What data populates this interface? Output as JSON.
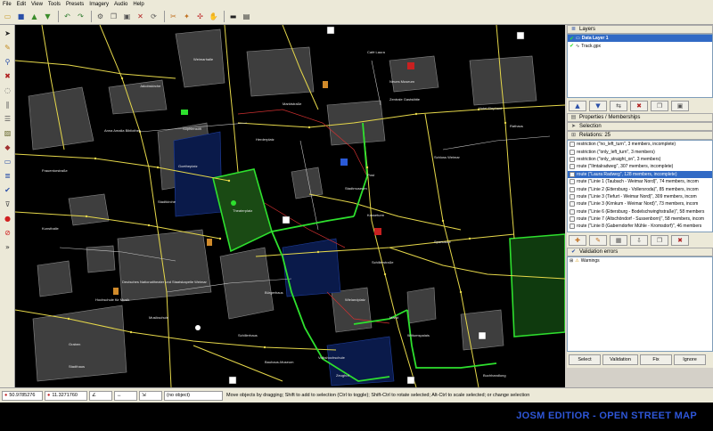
{
  "menu": [
    "File",
    "Edit",
    "View",
    "Tools",
    "Presets",
    "Imagery",
    "Audio",
    "Help"
  ],
  "toolbar_icons": [
    "open-icon",
    "save-icon",
    "upload-icon",
    "download-icon",
    "undo-icon",
    "redo-icon",
    "preferences-icon",
    "copy-icon",
    "paste-icon",
    "delete-icon",
    "refresh-icon",
    "scissors-icon",
    "wand-icon",
    "arrows-icon",
    "hand-icon",
    "bus-icon",
    "train-icon"
  ],
  "left_tools": [
    "select-icon",
    "draw-icon",
    "zoom-icon",
    "delete-icon",
    "lasso-icon",
    "parallel-icon",
    "align-icon",
    "photo-icon",
    "waypoint-icon",
    "bus-stop-icon",
    "layers-icon",
    "check-icon",
    "filter-icon",
    "error-icon",
    "cancel-icon"
  ],
  "layers": {
    "title": "Layers",
    "items": [
      {
        "name": "Data Layer 1",
        "selected": true
      },
      {
        "name": "Track.gpx",
        "selected": false
      }
    ]
  },
  "properties": {
    "title": "Properties / Memberships"
  },
  "selection": {
    "title": "Selection"
  },
  "relations": {
    "title": "Relations: 25",
    "items": [
      "restriction (\"no_left_turn\", 3 members, incomplete)",
      "restriction (\"only_left_turn\", 3 members)",
      "restriction (\"only_straight_on\", 3 members)",
      "route (\"Ilmtalradweg\", 307 members, incomplete)",
      "route (\"Laura Radweg\", 128 members, incomplete)",
      "route (\"Linie 1 (Taubach - Weimar Nord)\", 74 members, incom",
      "route (\"Linie 2 (Ettersburg - Vollersroda)\", 85 members, incom",
      "route (\"Linie 3 (Tiefurt - Weimar Nord)\", 309 members, incom",
      "route (\"Linie 3 (Kirnkum - Weimar Nord)\", 73 members, incom",
      "route (\"Linie 6 (Ettersburg - Bodelschwinghstraße)\", 58 members",
      "route (\"Linie 7 (Altschöndorf - Sussenborn)\", 58 members, incom",
      "route (\"Linie 8 (Gaberndorfer Mühle - Kromsdorf)\", 46 members"
    ],
    "selected_index": 4
  },
  "validation": {
    "title": "Validation errors",
    "warnings_label": "Warnings",
    "buttons": [
      "Select",
      "Validation",
      "Fix",
      "Ignore"
    ]
  },
  "status": {
    "lat": "50.9785276",
    "lon": "11.3271760",
    "object": "(no object)",
    "hint": "Move objects by dragging; Shift to add to selection (Ctrl to toggle); Shift-Ctrl to rotate selected; Alt-Ctrl to scale selected; or change selection"
  },
  "banner": "JOSM EDITIOR - OPEN STREET MAP",
  "colors": {
    "road": "#e6d84a",
    "route_green": "#2ee02e",
    "building": "#4b4b4b",
    "selected_row": "#316ac5",
    "banner_text": "#2e56d8"
  },
  "map_labels": [
    "Theaterplatz",
    "Wielandplatz",
    "Goetheplatz",
    "Sophienstift",
    "Marktstraße",
    "Schillerstraße",
    "Frauentorstraße",
    "Deutsches Nationaltheater und Staatskapelle Weimar",
    "Zentrale Gaststätte",
    "Rathaus",
    "Stadtmuseum",
    "Schloss Weimar",
    "Herderplatz",
    "Graben",
    "Bauhaus-Museum",
    "Kasseturm",
    "Wittumspalais",
    "Schillerhaus",
    "Hotel Elephant",
    "Anna Amalia Bibliothek",
    "Musikschule",
    "Buchhandlung",
    "Café Laura",
    "Stadthaus",
    "Zeughof",
    "Markt",
    "Post",
    "Volkshochschule",
    "Sparkasse",
    "Jakobskirche",
    "Hochschule für Musik",
    "Bürgerhaus",
    "Neues Museum",
    "Kunsthalle",
    "Weimarhalle",
    "Stadtkirche"
  ]
}
